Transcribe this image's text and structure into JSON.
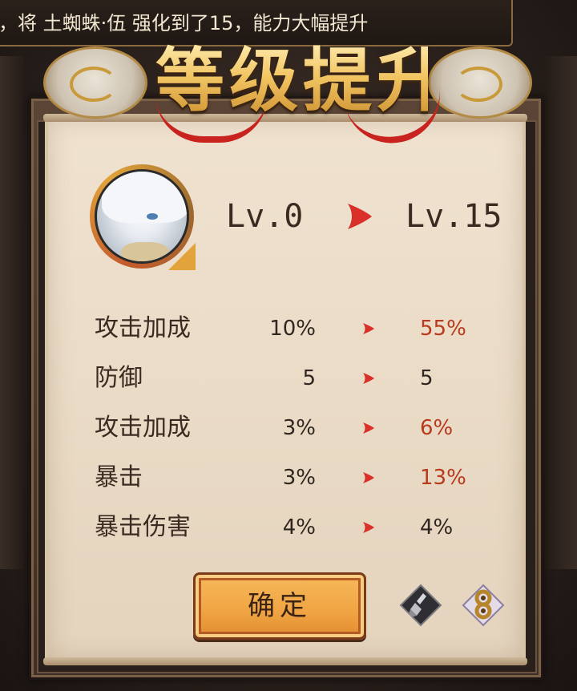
{
  "notification": {
    "text": "，将 土蜘蛛·伍 强化到了15，能力大幅提升"
  },
  "title": {
    "text": "等级提升"
  },
  "level": {
    "from": "Lv.0",
    "to": "Lv.15"
  },
  "stats": [
    {
      "label": "攻击加成",
      "old": "10%",
      "new": "55%",
      "changed": true
    },
    {
      "label": "防御",
      "old": "5",
      "new": "5",
      "changed": false
    },
    {
      "label": "攻击加成",
      "old": "3%",
      "new": "6%",
      "changed": true
    },
    {
      "label": "暴击",
      "old": "3%",
      "new": "13%",
      "changed": true
    },
    {
      "label": "暴击伤害",
      "old": "4%",
      "new": "4%",
      "changed": false
    }
  ],
  "buttons": {
    "confirm_label": "确定"
  },
  "icons": {
    "level_arrow": "red-arrow-right-icon",
    "stat_arrow": "small-red-arrow-right-icon",
    "avatar": "soul-avatar",
    "tool_left": "brush-icon",
    "tool_right": "gold-ornament-icon"
  },
  "colors": {
    "accent": "#d9302a",
    "increase": "#b83a1c",
    "normal": "#2f2620",
    "button": "#f0a443",
    "title_gold": "#f2c563"
  }
}
